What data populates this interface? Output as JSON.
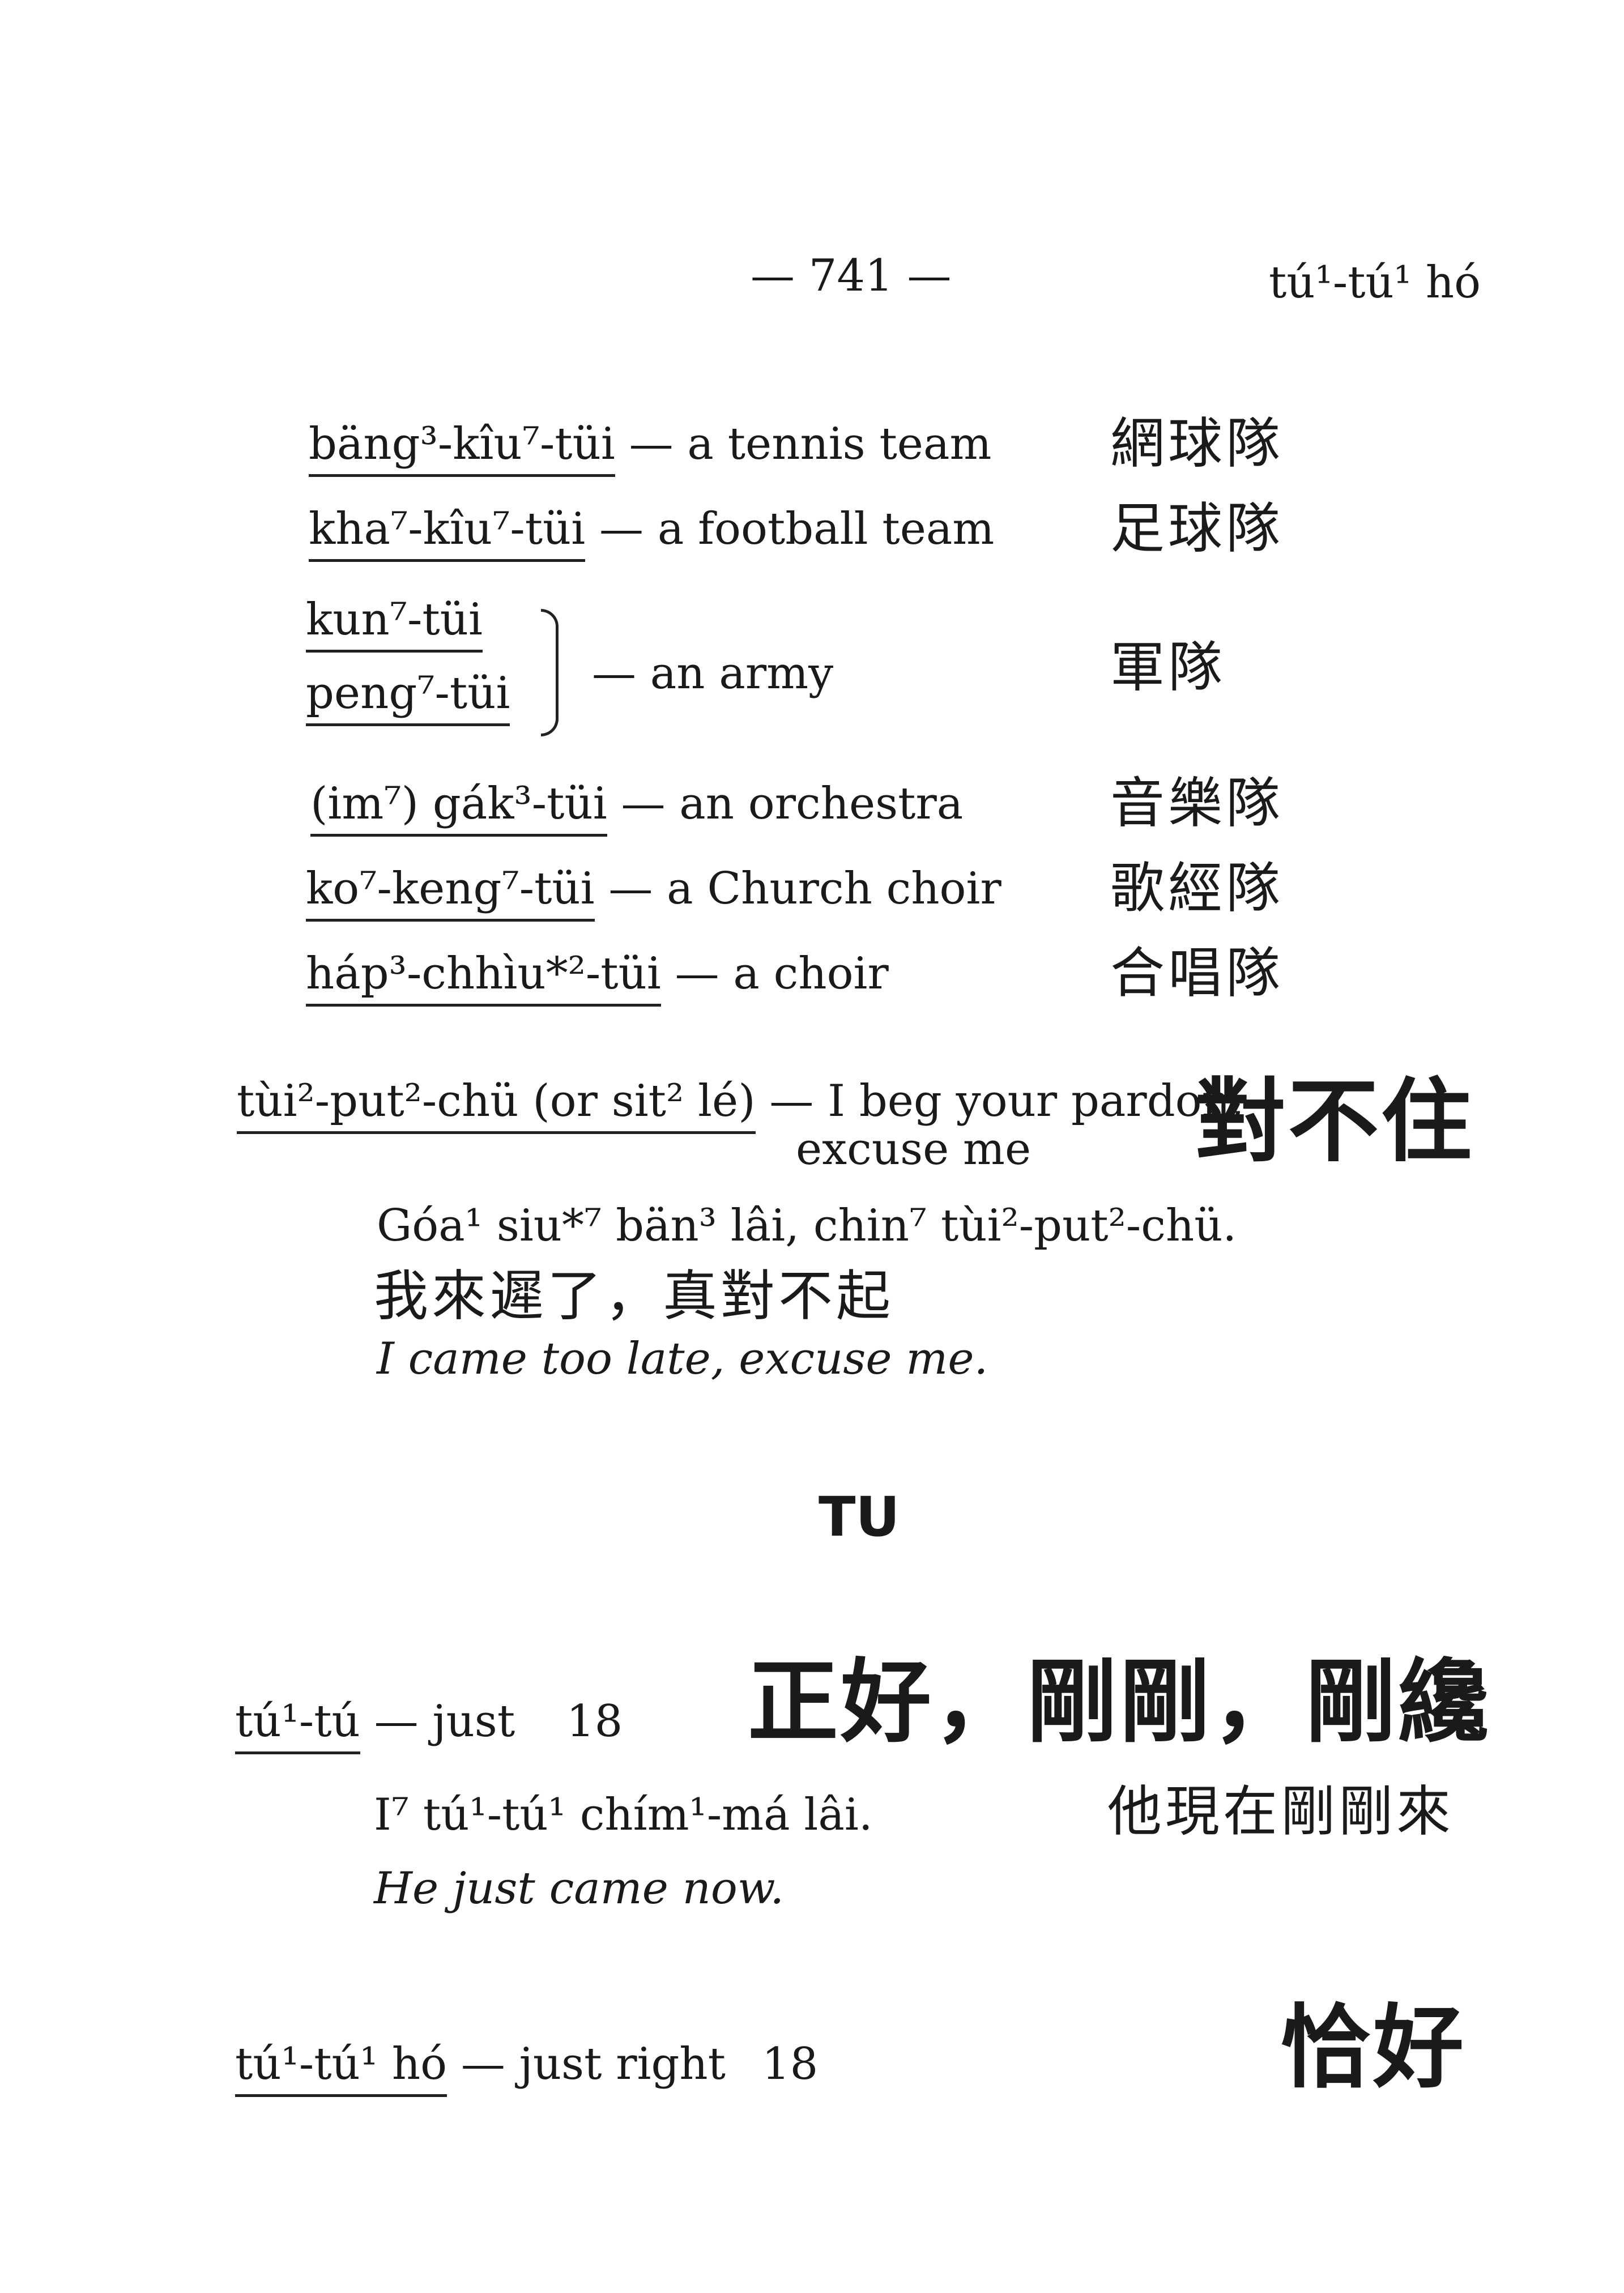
{
  "header": {
    "page_number": "— 741 —",
    "running_head": "tú¹-tú¹ hó"
  },
  "entries_tui": [
    {
      "term": "bäng³-kîu⁷-tüi",
      "gloss": " — a tennis team",
      "chinese": "網球隊"
    },
    {
      "term": "kha⁷-kîu⁷-tüi",
      "gloss": " — a football team",
      "chinese": "足球隊"
    },
    {
      "term": "(im⁷) gák³-tüi",
      "gloss": " — an orchestra",
      "chinese": "音樂隊"
    },
    {
      "term": "ko⁷-keng⁷-tüi",
      "gloss": " — a Church choir",
      "chinese": "歌經隊"
    },
    {
      "term": "háp³-chhìu*²-tüi",
      "gloss": " — a choir",
      "chinese": "合唱隊"
    }
  ],
  "army_group": {
    "term1": "kun⁷-tüi",
    "term2": "peng⁷-tüi",
    "gloss": "— an army",
    "chinese": "軍隊"
  },
  "pardon_entry": {
    "term": "tùi²-put²-chü (or sit² lé)",
    "gloss_line1": " — I beg your pardon,",
    "gloss_line2": "excuse me",
    "chinese": "對不住",
    "example_rom": "Góa¹ siu*⁷ bän³ lâi, chin⁷ tùi²-put²-chü.",
    "example_chinese": "我來遲了，真對不起",
    "example_en": "I came too late, excuse me."
  },
  "section_heading": "TU",
  "tutu_entry": {
    "term": "tú¹-tú",
    "gloss": " — just",
    "ref": "18",
    "chinese": "正好，剛剛，剛纔",
    "example_rom": "I⁷ tú¹-tú¹ chím¹-má lâi.",
    "example_chinese": "他現在剛剛來",
    "example_en": "He just came now."
  },
  "tutuho_entry": {
    "term": "tú¹-tú¹ hó",
    "gloss": " — just right",
    "ref": "18",
    "chinese": "恰好"
  }
}
